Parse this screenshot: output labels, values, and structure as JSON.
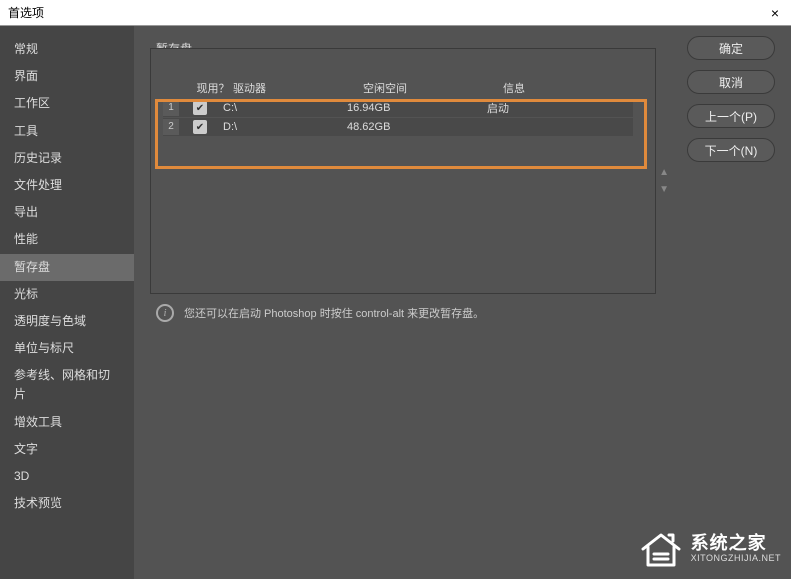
{
  "window": {
    "title": "首选项",
    "close": "×"
  },
  "sidebar": {
    "items": [
      "常规",
      "界面",
      "工作区",
      "工具",
      "历史记录",
      "文件处理",
      "导出",
      "性能",
      "暂存盘",
      "光标",
      "透明度与色域",
      "单位与标尺",
      "参考线、网格和切片",
      "增效工具",
      "文字",
      "3D",
      "技术预览"
    ],
    "selected_index": 8
  },
  "section": {
    "title": "暂存盘",
    "headers": {
      "active": "现用？",
      "drive": "驱动器",
      "space": "空闲空间",
      "info": "信息"
    },
    "rows": [
      {
        "num": "1",
        "checked": true,
        "drive": "C:\\",
        "space": "16.94GB",
        "info": "启动"
      },
      {
        "num": "2",
        "checked": true,
        "drive": "D:\\",
        "space": "48.62GB",
        "info": ""
      }
    ],
    "hint": "您还可以在启动 Photoshop 时按住 control-alt 来更改暂存盘。"
  },
  "buttons": {
    "ok": "确定",
    "cancel": "取消",
    "prev": "上一个(P)",
    "next": "下一个(N)"
  },
  "watermark": {
    "zh": "系统之家",
    "en": "XITONGZHIJIA.NET"
  }
}
